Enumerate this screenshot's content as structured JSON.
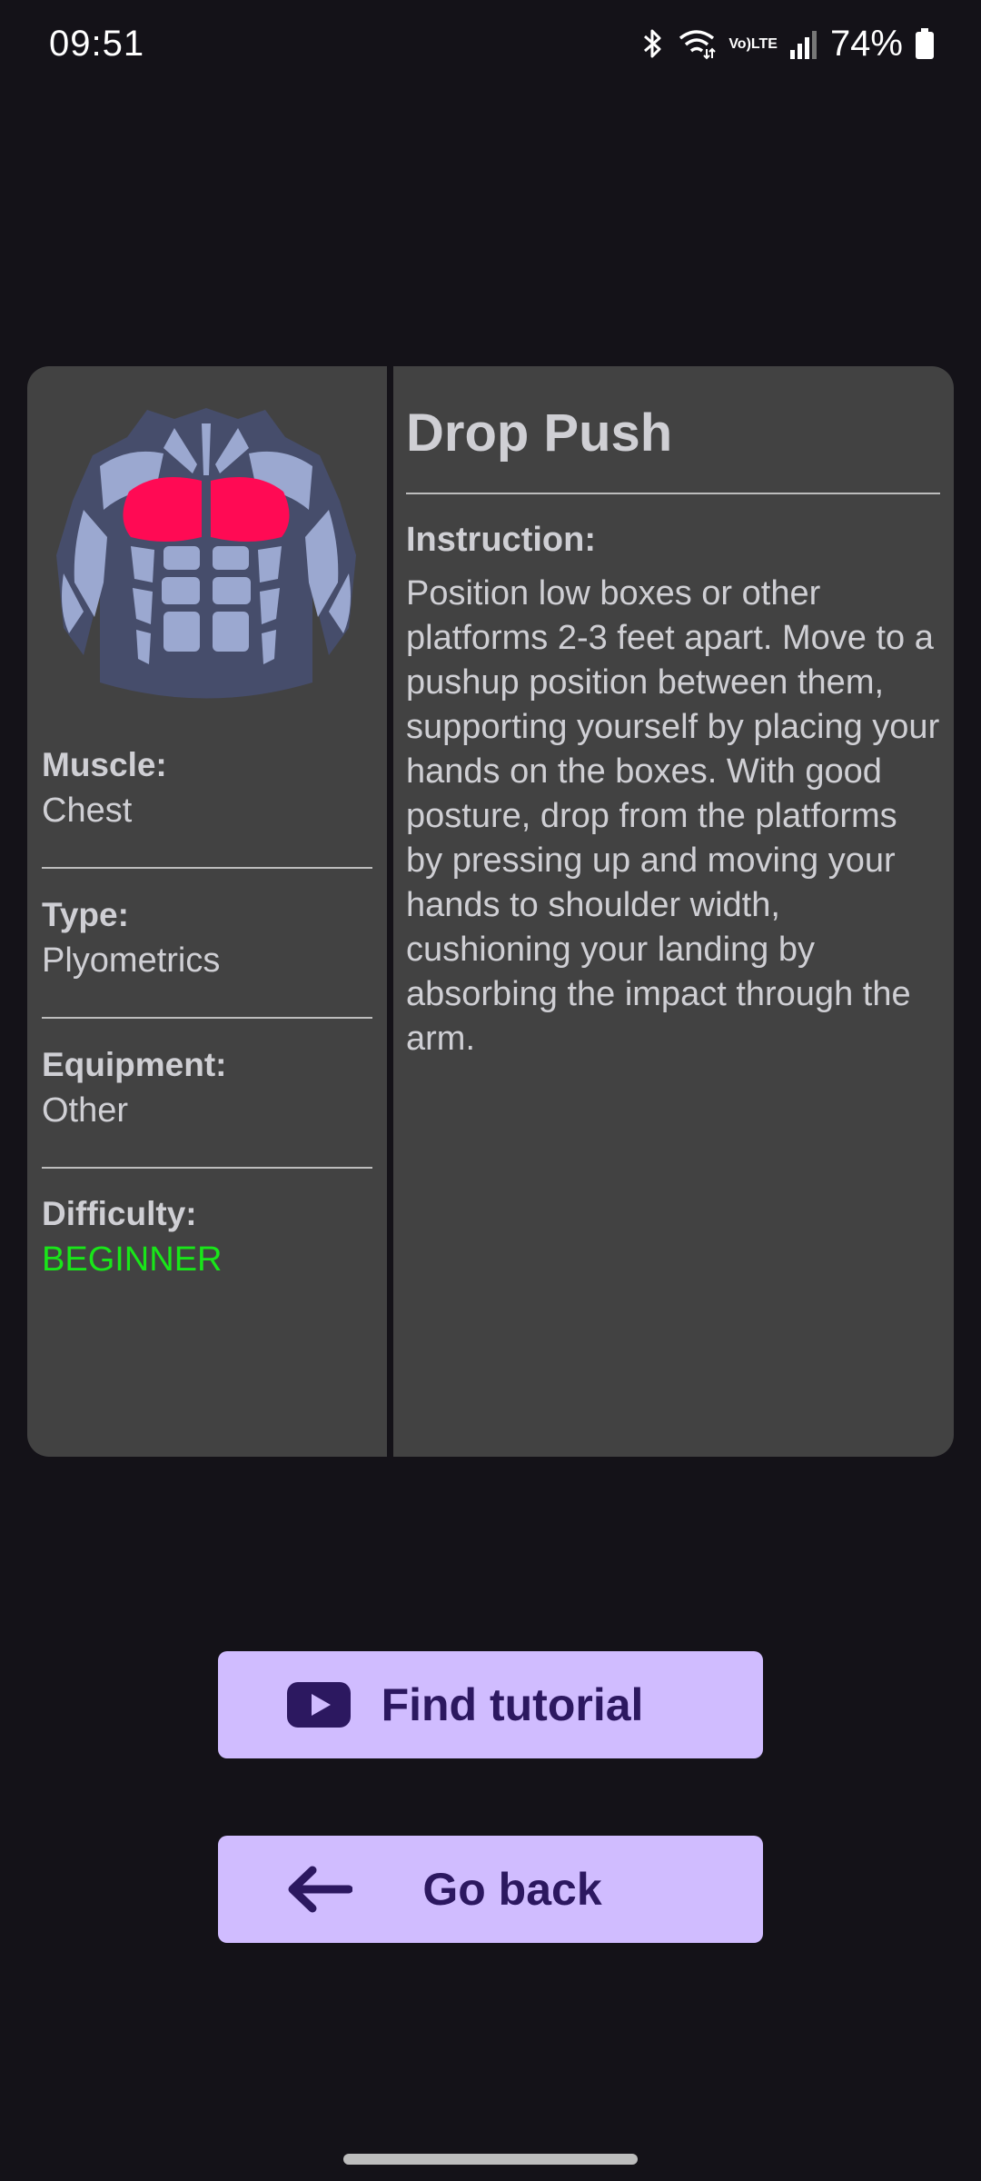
{
  "status_bar": {
    "time": "09:51",
    "volte_line1": "Vo)",
    "volte_line2": "LTE",
    "battery_percent": "74%"
  },
  "exercise": {
    "title": "Drop Push",
    "muscle_label": "Muscle:",
    "muscle_value": "Chest",
    "type_label": "Type:",
    "type_value": "Plyometrics",
    "equipment_label": "Equipment:",
    "equipment_value": "Other",
    "difficulty_label": "Difficulty:",
    "difficulty_value": "BEGINNER",
    "instruction_label": "Instruction:",
    "instruction_text": "Position low boxes or other platforms 2-3 feet apart. Move to a pushup position between them, supporting yourself by placing your hands on the boxes. With good posture, drop from the platforms by pressing up and moving your hands to shoulder width, cushioning your landing by absorbing the impact through the arm."
  },
  "buttons": {
    "find_tutorial": "Find tutorial",
    "go_back": "Go back"
  },
  "colors": {
    "background": "#141218",
    "card": "#424242",
    "button": "#d0bcff",
    "button_text": "#2c1860",
    "highlight_muscle": "#ff0a54",
    "beginner": "#19e619"
  },
  "icons": {
    "bluetooth": "bluetooth-icon",
    "wifi": "wifi-icon",
    "signal": "signal-icon",
    "battery": "battery-icon",
    "youtube": "youtube-icon",
    "back_arrow": "arrow-left-icon"
  }
}
